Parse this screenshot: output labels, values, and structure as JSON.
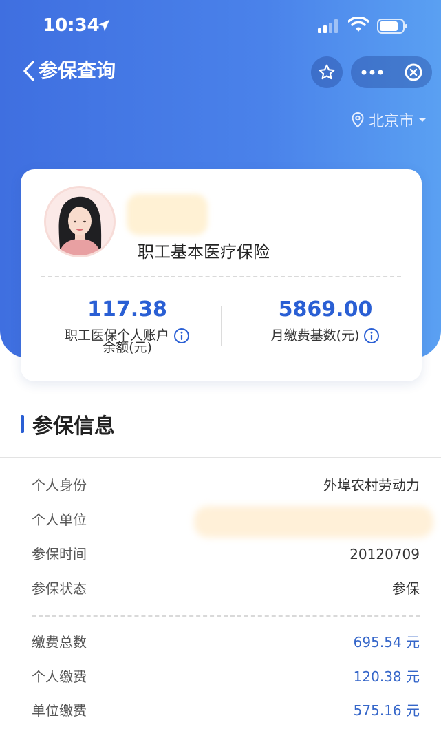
{
  "status_bar": {
    "time": "10:34"
  },
  "nav": {
    "title": "参保查询"
  },
  "city": "北京市",
  "card": {
    "insurance_type": "职工基本医疗保险",
    "balance_value": "117.38",
    "balance_label_line1": "职工医保个人账户",
    "balance_label_line2": "余额(元)",
    "base_value": "5869.00",
    "base_label": "月缴费基数(元)"
  },
  "section": {
    "title": "参保信息"
  },
  "info_rows": [
    {
      "key": "个人身份",
      "value": "外埠农村劳动力"
    },
    {
      "key": "个人单位",
      "value": ""
    },
    {
      "key": "参保时间",
      "value": "20120709"
    },
    {
      "key": "参保状态",
      "value": "参保"
    }
  ],
  "payment_rows": [
    {
      "key": "缴费总数",
      "value": "695.54 元"
    },
    {
      "key": "个人缴费",
      "value": "120.38 元"
    },
    {
      "key": "单位缴费",
      "value": "575.16 元"
    }
  ],
  "colors": {
    "accent": "#2a5fd4",
    "header": "#4a82ea"
  }
}
